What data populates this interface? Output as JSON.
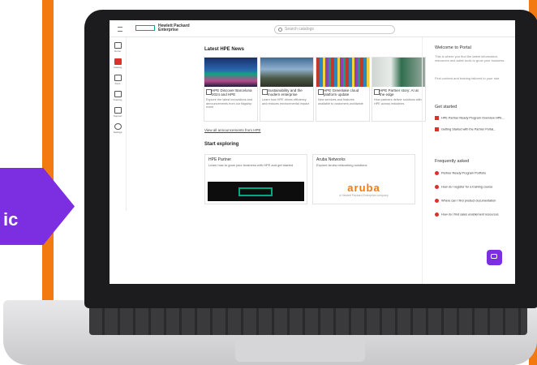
{
  "badge": {
    "text": "ic",
    "color": "#7b2fe0"
  },
  "accent_color": "#f37a10",
  "app": {
    "brand": "Hewlett Packard Enterprise",
    "search_placeholder": "Search catalogs"
  },
  "sidebar": {
    "items": [
      {
        "label": "Home",
        "icon": "home-icon"
      },
      {
        "label": "Catalog",
        "icon": "catalog-icon"
      },
      {
        "label": "Docs",
        "icon": "docs-icon"
      },
      {
        "label": "Training",
        "icon": "training-icon"
      },
      {
        "label": "Support",
        "icon": "support-icon"
      },
      {
        "label": "Settings",
        "icon": "gear-icon"
      }
    ]
  },
  "news": {
    "heading": "Latest HPE News",
    "cards": [
      {
        "title": "HPE Discover Barcelona 2024 and HPE",
        "desc": "Explore the latest innovations and announcements from our flagship event"
      },
      {
        "title": "Sustainability and the modern enterprise",
        "desc": "Learn how HPE drives efficiency and reduces environmental impact"
      },
      {
        "title": "HPE Greenlake cloud platform update",
        "desc": "New services and features available to customers worldwide"
      },
      {
        "title": "HPE Partner story: AI at the edge",
        "desc": "How partners deliver solutions with HPE across industries"
      }
    ],
    "view_all": "View all announcements from HPE"
  },
  "start_playing": {
    "heading": "Start exploring",
    "cards": [
      {
        "title": "HPE Partner",
        "desc": "Learn how to grow your business with HPE and get started"
      },
      {
        "title": "Aruba Networks",
        "desc": "Explore Aruba networking solutions",
        "logo": "aruba",
        "logo_sub": "a Hewlett Packard Enterprise company"
      }
    ]
  },
  "right_panel": {
    "welcome_heading": "Welcome to Portal",
    "welcome_text_1": "This is where you find the latest information, resources and sales tools to grow your business.",
    "welcome_text_2": "Find content and training tailored to your role.",
    "getting_started_heading": "Get started",
    "pdfs": [
      "HPE Partner Ready Program Overview HPE...",
      "Getting Started with the Partner Portal..."
    ],
    "faq_heading": "Frequently asked",
    "faqs": [
      "Partner Ready Program Portfolio",
      "How do I register for a training course",
      "Where can I find product documentation",
      "How do I find sales enablement resources"
    ]
  }
}
